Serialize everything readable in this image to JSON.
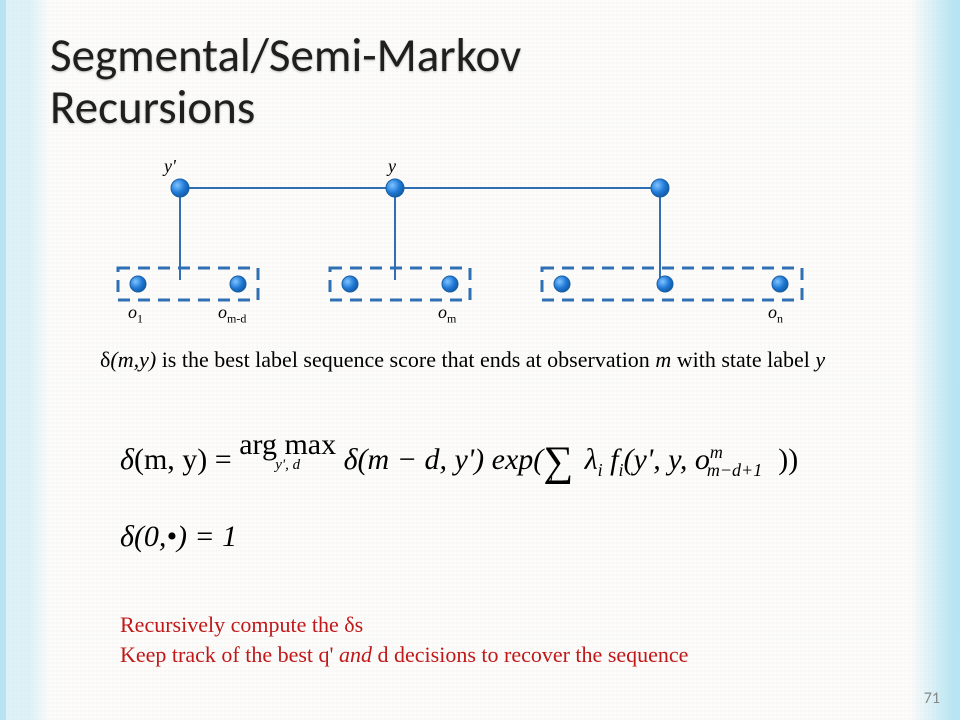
{
  "title_line1": "Segmental/Semi-Markov",
  "title_line2": "Recursions",
  "diagram": {
    "top_labels": {
      "y_prime": "y'",
      "y": "y"
    },
    "obs_labels": {
      "o1": "o",
      "o1_sub": "1",
      "om_d": "o",
      "om_d_sub": "m-d",
      "om": "o",
      "om_sub": "m",
      "on": "o",
      "on_sub": "n"
    }
  },
  "desc": {
    "delta": "δ",
    "args": "(m,y)",
    "rest": " is the best label sequence score that ends at observation ",
    "m": "m",
    "rest2": " with state label ",
    "y": "y"
  },
  "eq1": {
    "lhs_delta": "δ",
    "lhs_args": "(m, y) = ",
    "argmax": "arg max",
    "argmax_sub": "y', d",
    "rhs1": " δ(m − d, y') exp(",
    "sum": "∑",
    "sum_sub": "i",
    "lam": " λ",
    "lam_sub": "i",
    "f": " f",
    "f_sub": "i",
    "fargs": "(y', y, o",
    "o_sup": "m",
    "o_sub": "m−d+1",
    "close": "))"
  },
  "eq2": {
    "text": "δ(0,•) = 1"
  },
  "note": {
    "line1a": "Recursively compute the ",
    "line1b": "δ",
    "line1c": "s",
    "line2a": "Keep track of the best q' ",
    "line2b": "and",
    "line2c": " d decisions to recover the sequence"
  },
  "page_number": "71"
}
